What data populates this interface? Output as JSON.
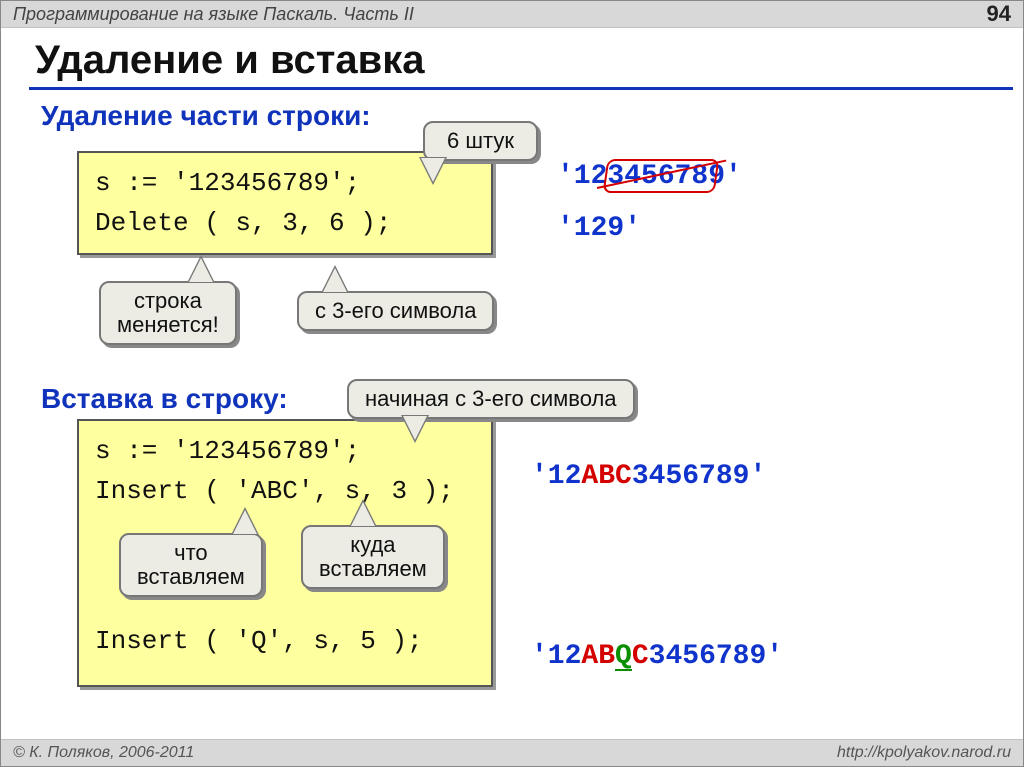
{
  "header": {
    "title": "Программирование на языке Паскаль. Часть II",
    "page": "94"
  },
  "footer": {
    "left": "© К. Поляков, 2006-2011",
    "right": "http://kpolyakov.narod.ru"
  },
  "main_title": "Удаление и вставка",
  "section1": {
    "title": "Удаление части строки:",
    "code_line1": "s := '123456789';",
    "code_line2": "Delete ( s, 3, 6 );",
    "callout_count": "6 штук",
    "callout_string_changes_l1": "строка",
    "callout_string_changes_l2": "меняется!",
    "callout_from3": "с 3-его символа",
    "result1_pre": "'12",
    "result1_strike": "345678",
    "result1_post": "9'",
    "result2": "'129'"
  },
  "section2": {
    "title": "Вставка в строку:",
    "code_line1": "s := '123456789';",
    "code_line2": "Insert ( 'ABC', s, 3 );",
    "code_line3": "Insert ( 'Q', s, 5 );",
    "callout_start3": "начиная с 3-его символа",
    "callout_what_l1": "что",
    "callout_what_l2": "вставляем",
    "callout_where_l1": "куда",
    "callout_where_l2": "вставляем",
    "result1_pre": "'12",
    "result1_ins": "ABC",
    "result1_post": "3456789'",
    "result2_pre": "'12",
    "result2_ab": "AB",
    "result2_q": "Q",
    "result2_c": "C",
    "result2_post": "3456789'"
  }
}
